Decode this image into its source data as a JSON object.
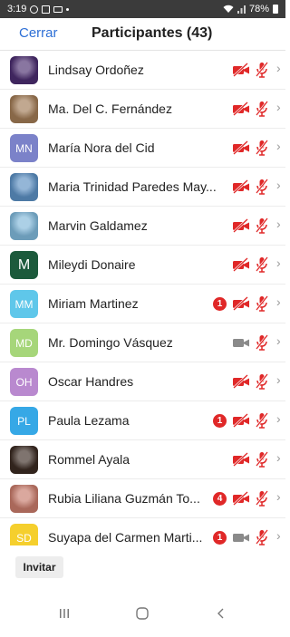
{
  "status_bar": {
    "time": "3:19",
    "battery": "78%"
  },
  "header": {
    "close_label": "Cerrar",
    "title": "Participantes (43)"
  },
  "colors": {
    "accent": "#2d6fd6",
    "muted_red": "#e02828",
    "video_gray": "#8a8a8a",
    "status_bar_bg": "#3b3b3b"
  },
  "participants": [
    {
      "name": "Lindsay Ordoñez",
      "avatar_initials": "",
      "avatar_type": "photo",
      "avatar_color": "#4a2c6e",
      "video": "off",
      "mic": "muted",
      "chat_badge": ""
    },
    {
      "name": "Ma. Del C. Fernández",
      "avatar_initials": "",
      "avatar_type": "photo",
      "avatar_color": "#a07a55",
      "video": "off",
      "mic": "muted",
      "chat_badge": ""
    },
    {
      "name": "María Nora del Cid",
      "avatar_initials": "MN",
      "avatar_type": "initials",
      "avatar_color": "#7b82c9",
      "video": "off",
      "mic": "muted",
      "chat_badge": ""
    },
    {
      "name": "Maria Trinidad Paredes May...",
      "avatar_initials": "",
      "avatar_type": "photo",
      "avatar_color": "#5b8fc2",
      "video": "off",
      "mic": "muted",
      "chat_badge": ""
    },
    {
      "name": "Marvin Galdamez",
      "avatar_initials": "",
      "avatar_type": "photo",
      "avatar_color": "#7fb7d9",
      "video": "off",
      "mic": "muted",
      "chat_badge": ""
    },
    {
      "name": "Mileydi Donaire",
      "avatar_initials": "M",
      "avatar_type": "initials-large",
      "avatar_color": "#1c5a3c",
      "video": "off",
      "mic": "muted",
      "chat_badge": ""
    },
    {
      "name": "Miriam Martinez",
      "avatar_initials": "MM",
      "avatar_type": "initials",
      "avatar_color": "#5fc7ea",
      "video": "off",
      "mic": "muted",
      "chat_badge": "1"
    },
    {
      "name": "Mr. Domingo Vásquez",
      "avatar_initials": "MD",
      "avatar_type": "initials",
      "avatar_color": "#a6d67a",
      "video": "on",
      "mic": "muted",
      "chat_badge": ""
    },
    {
      "name": "Oscar Handres",
      "avatar_initials": "OH",
      "avatar_type": "initials",
      "avatar_color": "#b989cf",
      "video": "off",
      "mic": "muted",
      "chat_badge": ""
    },
    {
      "name": "Paula Lezama",
      "avatar_initials": "PL",
      "avatar_type": "initials",
      "avatar_color": "#36a8e6",
      "video": "off",
      "mic": "muted",
      "chat_badge": "1"
    },
    {
      "name": "Rommel Ayala",
      "avatar_initials": "",
      "avatar_type": "photo",
      "avatar_color": "#3a2a22",
      "video": "off",
      "mic": "muted",
      "chat_badge": ""
    },
    {
      "name": "Rubia Liliana Guzmán To...",
      "avatar_initials": "",
      "avatar_type": "photo",
      "avatar_color": "#c77a6a",
      "video": "off",
      "mic": "muted",
      "chat_badge": "4"
    },
    {
      "name": "Suyapa del Carmen Marti...",
      "avatar_initials": "SD",
      "avatar_type": "initials",
      "avatar_color": "#f5cf2d",
      "video": "on",
      "mic": "muted",
      "chat_badge": "1"
    }
  ],
  "footer": {
    "invite_label": "Invitar"
  },
  "icons": {
    "video_off": "video-off-icon",
    "video_on": "video-icon",
    "mic_muted": "mic-muted-icon",
    "chevron": "chevron-right-icon"
  }
}
